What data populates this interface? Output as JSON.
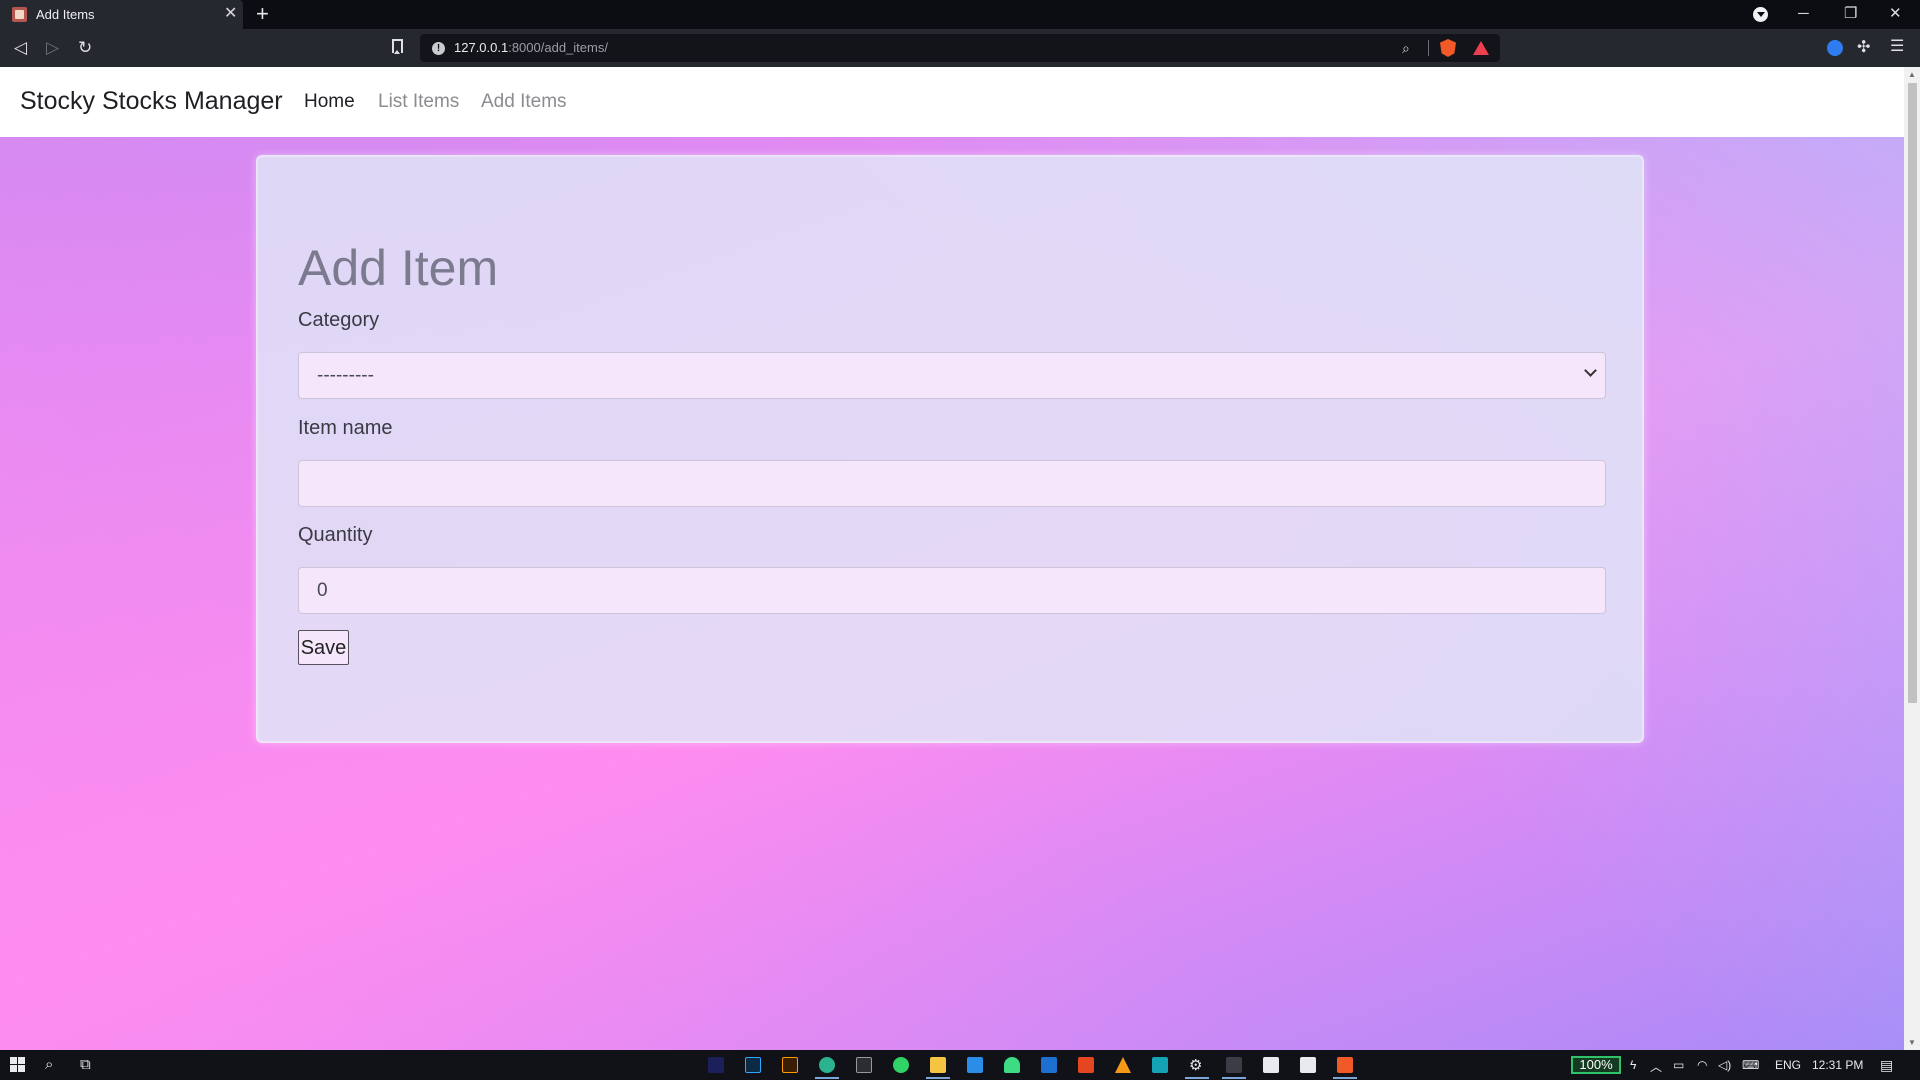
{
  "browser": {
    "tab_title": "Add Items",
    "url_host": "127.0.0.1",
    "url_path": ":8000/add_items/"
  },
  "navbar": {
    "brand": "Stocky Stocks Manager",
    "links": [
      "Home",
      "List Items",
      "Add Items"
    ],
    "active_link": "Home"
  },
  "form": {
    "title": "Add Item",
    "category_label": "Category",
    "category_selected": "---------",
    "item_name_label": "Item name",
    "item_name_value": "",
    "quantity_label": "Quantity",
    "quantity_value": "0",
    "save_label": "Save"
  },
  "taskbar": {
    "battery": "100%",
    "language": "ENG",
    "clock": "12:31 PM",
    "apps": [
      "premiere-icon",
      "photoshop-icon",
      "illustrator-icon",
      "edge-icon",
      "terminal-icon",
      "whatsapp-icon",
      "file-explorer-icon",
      "vscode-icon",
      "android-studio-icon",
      "blue-app-icon",
      "office-icon",
      "vlc-icon",
      "green-app-icon",
      "settings-icon",
      "app-icon",
      "media-icon",
      "store-icon",
      "brave-icon"
    ]
  },
  "colors": {
    "navbar_bg": "#ffffff",
    "card_bg": "#e0e4f7",
    "input_bg": "#f5e6fb",
    "gradient_pink": "#ff8cf0",
    "gradient_violet": "#a98af6"
  }
}
